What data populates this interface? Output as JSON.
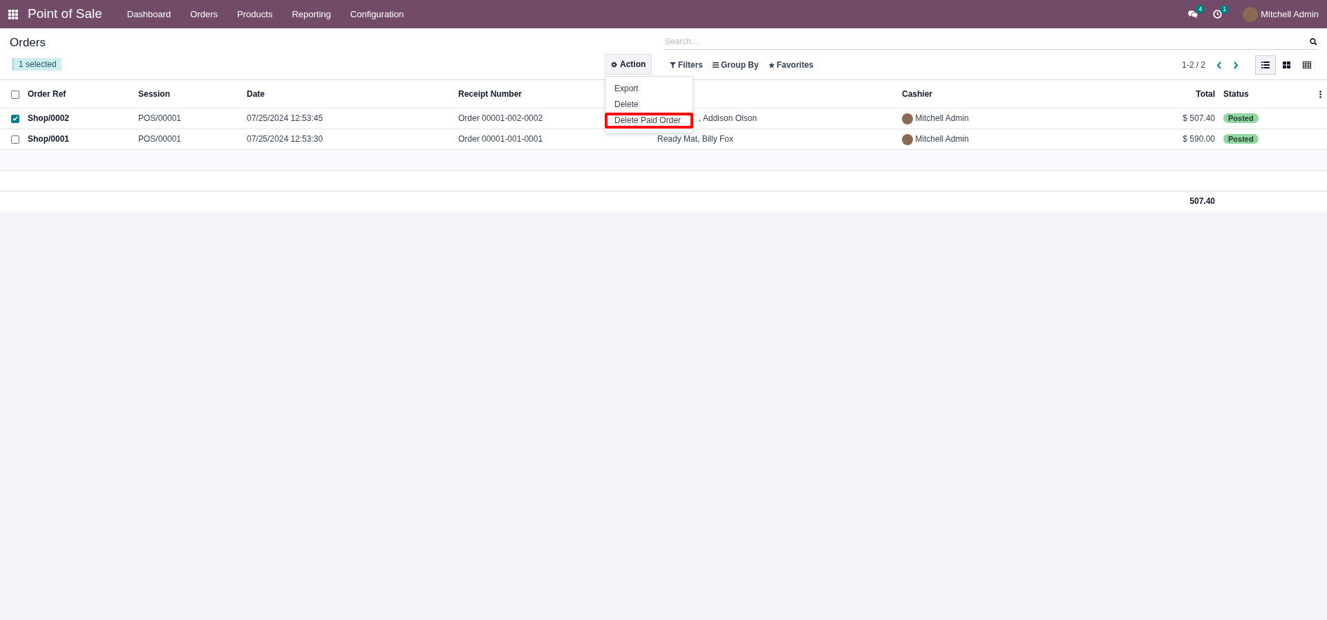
{
  "navbar": {
    "app_title": "Point of Sale",
    "menu": [
      "Dashboard",
      "Orders",
      "Products",
      "Reporting",
      "Configuration"
    ],
    "messages_badge": "4",
    "activities_badge": "1",
    "user": "Mitchell Admin"
  },
  "control_panel": {
    "title": "Orders",
    "selection_badge": "1 selected",
    "action_button": "Action",
    "action_menu": [
      {
        "label": "Export",
        "highlighted": false
      },
      {
        "label": "Delete",
        "highlighted": false
      },
      {
        "label": "Delete Paid Order",
        "highlighted": true
      }
    ],
    "search": {
      "placeholder": "Search..."
    },
    "filters": [
      {
        "kind": "filter",
        "label": "Filters"
      },
      {
        "kind": "group",
        "label": "Group By"
      },
      {
        "kind": "favorite",
        "label": "Favorites"
      }
    ],
    "pager": "1-2 / 2",
    "views": [
      {
        "kind": "list",
        "selected": true
      },
      {
        "kind": "kanban",
        "selected": false
      },
      {
        "kind": "pivot",
        "selected": false
      }
    ]
  },
  "table": {
    "all_selected": false,
    "columns": [
      {
        "label": "Order Ref"
      },
      {
        "label": "Session"
      },
      {
        "label": "Date"
      },
      {
        "label": "Receipt Number"
      },
      {},
      {
        "label": "Cashier"
      },
      {
        "label": "Total"
      },
      {
        "label": "Status"
      }
    ],
    "rows": [
      {
        "selected": true,
        "customer_covered": true,
        "cells": [
          "Shop/0002",
          "POS/00001",
          "07/25/2024 12:53:45",
          "Order 00001-002-0002",
          ", Addison Olson",
          "Mitchell Admin",
          "$ 507.40"
        ],
        "status": "Posted"
      },
      {
        "selected": false,
        "customer_covered": false,
        "cells": [
          "Shop/0001",
          "POS/00001",
          "07/25/2024 12:53:30",
          "Order 00001-001-0001",
          "Ready Mat, Billy Fox",
          "Mitchell Admin",
          "$ 590.00"
        ],
        "status": "Posted"
      }
    ],
    "footer_total": "507.40"
  }
}
